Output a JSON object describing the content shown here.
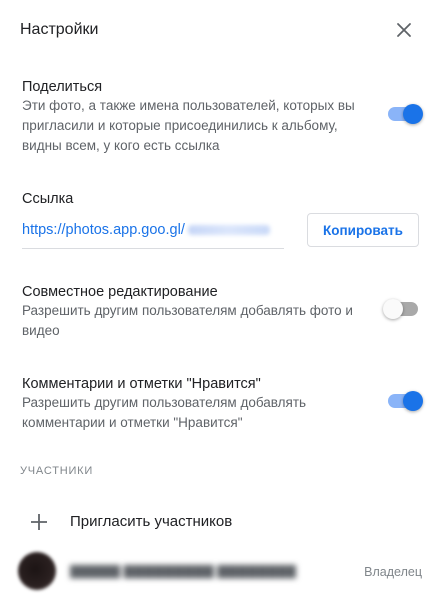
{
  "header": {
    "title": "Настройки",
    "close_icon": "close-icon"
  },
  "share": {
    "title": "Поделиться",
    "description": "Эти фото, а также имена пользователей, которых вы пригласили и которые присоединились к альбому, видны всем, у кого есть ссылка",
    "enabled": true
  },
  "link": {
    "title": "Ссылка",
    "url_prefix": "https://photos.app.goo.gl/",
    "copy_label": "Копировать"
  },
  "collab": {
    "title": "Совместное редактирование",
    "description": "Разрешить другим пользователям добавлять фото и видео",
    "enabled": false
  },
  "comments": {
    "title": "Комментарии и отметки \"Нравится\"",
    "description": "Разрешить другим пользователям добавлять комментарии и отметки \"Нравится\"",
    "enabled": true
  },
  "participants": {
    "label": "УЧАСТНИКИ",
    "invite_label": "Пригласить участников",
    "invite_icon": "plus-icon",
    "members": [
      {
        "role": "Владелец"
      }
    ]
  },
  "colors": {
    "accent": "#1a73e8",
    "toggle_track_on": "#8ab4f8",
    "toggle_track_off": "#a9a9a9",
    "text_secondary": "#5f6368"
  }
}
